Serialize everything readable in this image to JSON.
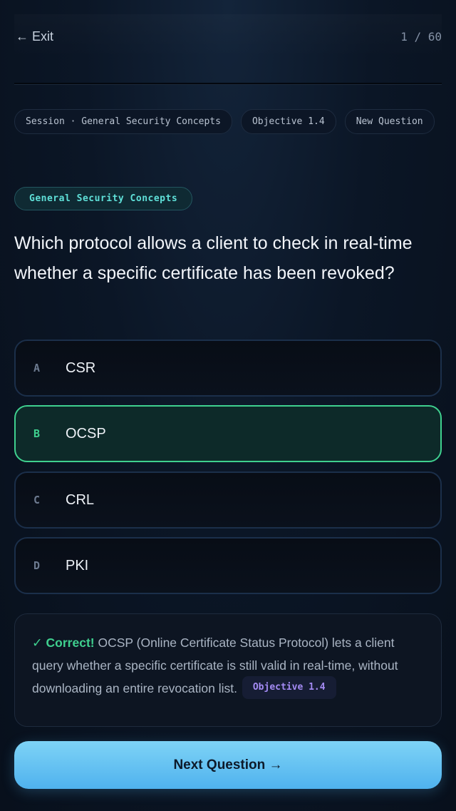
{
  "header": {
    "exit_label": "← Exit",
    "progress": "1 / 60"
  },
  "chips": [
    "Session · General Security Concepts",
    "Objective 1.4",
    "New Question"
  ],
  "category": "General Security Concepts",
  "question": "Which protocol allows a client to check in real-time whether a specific certificate has been revoked?",
  "options": [
    {
      "letter": "A",
      "text": "CSR",
      "state": "default"
    },
    {
      "letter": "B",
      "text": "OCSP",
      "state": "correct"
    },
    {
      "letter": "C",
      "text": "CRL",
      "state": "default"
    },
    {
      "letter": "D",
      "text": "PKI",
      "state": "default"
    }
  ],
  "feedback": {
    "status": "✓ Correct!",
    "explanation": "OCSP (Online Certificate Status Protocol) lets a client query whether a specific certificate is still valid in real-time, without downloading an entire revocation list.",
    "objective": "Objective 1.4"
  },
  "next_button": "Next Question →",
  "colors": {
    "accent": "#4fb2ee",
    "correct": "#3fd08f",
    "category": "#5fe0d8",
    "objective": "#a48bf4"
  }
}
